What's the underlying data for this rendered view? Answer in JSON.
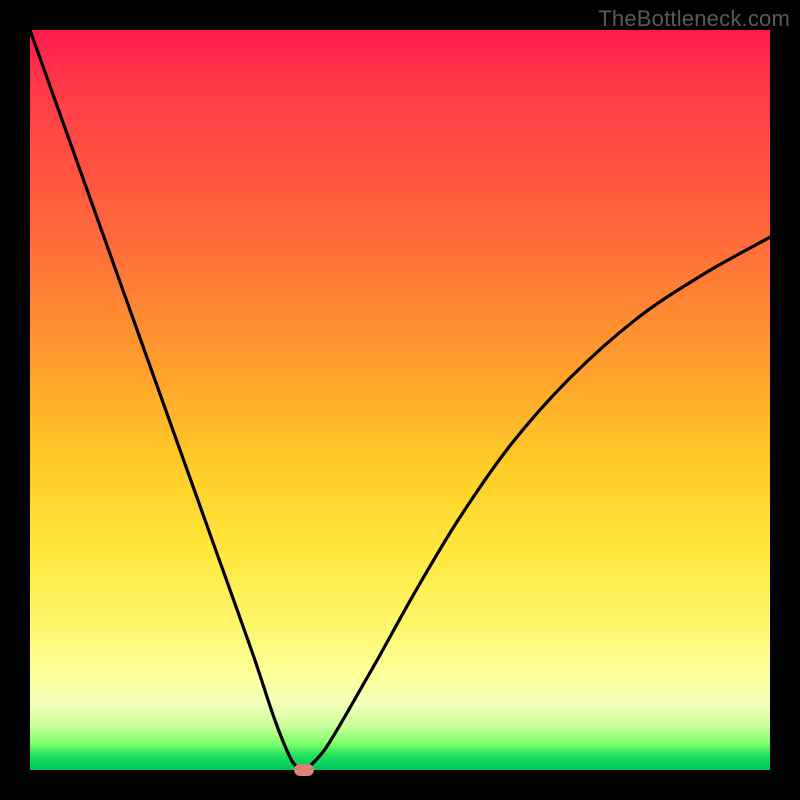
{
  "watermark": "TheBottleneck.com",
  "colors": {
    "frame": "#000000",
    "curve_stroke": "#000000",
    "dot_fill": "#d98077",
    "gradient_stops": [
      "#ff1a4b",
      "#ff6a3a",
      "#ffc928",
      "#fdff9a",
      "#00c45a"
    ]
  },
  "chart_data": {
    "type": "line",
    "title": "",
    "xlabel": "",
    "ylabel": "",
    "xlim": [
      0,
      100
    ],
    "ylim": [
      0,
      100
    ],
    "grid": false,
    "legend": false,
    "annotations": [],
    "marker": {
      "x": 37,
      "y": 0
    },
    "series": [
      {
        "name": "curve",
        "x": [
          0,
          5,
          10,
          15,
          20,
          25,
          30,
          33,
          35,
          36,
          37,
          38,
          40,
          43,
          47,
          52,
          58,
          65,
          73,
          82,
          91,
          100
        ],
        "values": [
          100,
          86,
          72,
          58,
          44,
          30,
          16,
          7,
          2,
          0.5,
          0,
          0.7,
          3,
          8,
          15,
          24,
          34,
          44,
          53,
          61,
          67,
          72
        ]
      }
    ]
  }
}
